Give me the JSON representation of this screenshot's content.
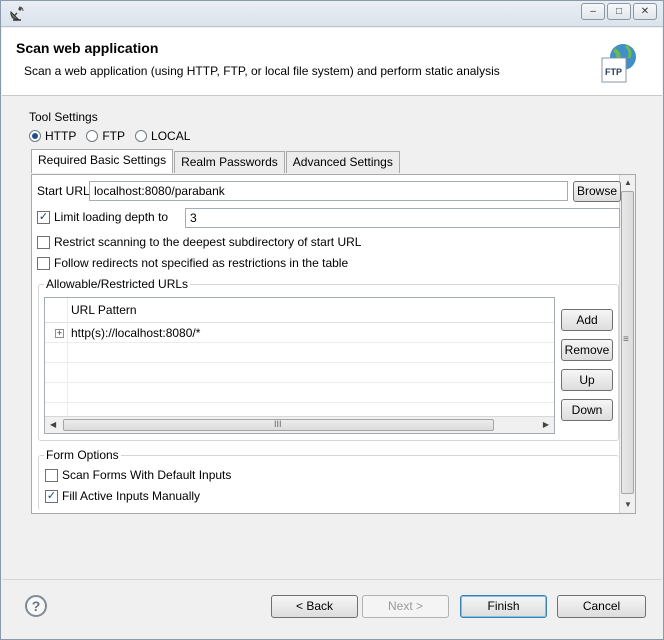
{
  "window": {
    "minimize_glyph": "‒",
    "maximize_glyph": "□",
    "close_glyph": "✕"
  },
  "header": {
    "title": "Scan web application",
    "description": "Scan a web application (using HTTP, FTP, or local file system) and perform static analysis",
    "logo_label": "FTP"
  },
  "tool_settings": {
    "label": "Tool Settings",
    "protocols": [
      {
        "label": "HTTP",
        "selected": true
      },
      {
        "label": "FTP",
        "selected": false
      },
      {
        "label": "LOCAL",
        "selected": false
      }
    ]
  },
  "tabs": [
    {
      "label": "Required Basic Settings",
      "active": true
    },
    {
      "label": "Realm Passwords",
      "active": false
    },
    {
      "label": "Advanced Settings",
      "active": false
    }
  ],
  "basic": {
    "start_url_label": "Start URL",
    "start_url_value": "localhost:8080/parabank",
    "browse_label": "Browse",
    "limit_depth_label": "Limit loading depth to",
    "limit_depth_checked": true,
    "limit_depth_value": "3",
    "restrict_label": "Restrict scanning to the deepest subdirectory of start URL",
    "restrict_checked": false,
    "follow_label": "Follow redirects not specified as restrictions in the table",
    "follow_checked": false
  },
  "urls": {
    "group_label": "Allowable/Restricted URLs",
    "column_header": "URL Pattern",
    "rows": [
      "http(s)://localhost:8080/*"
    ],
    "expander_glyph": "+",
    "add_label": "Add",
    "remove_label": "Remove",
    "up_label": "Up",
    "down_label": "Down",
    "scroll_grip": "III",
    "vscroll_grip": "≡"
  },
  "form_options": {
    "group_label": "Form Options",
    "scan_default_label": "Scan Forms With Default Inputs",
    "scan_default_checked": false,
    "fill_manual_label": "Fill Active Inputs Manually",
    "fill_manual_checked": true
  },
  "footer": {
    "help_glyph": "?",
    "back_label": "< Back",
    "next_label": "Next >",
    "finish_label": "Finish",
    "cancel_label": "Cancel"
  },
  "glyphs": {
    "check": "✓",
    "arrow_up": "▲",
    "arrow_down": "▼",
    "arrow_left": "◀",
    "arrow_right": "▶"
  }
}
